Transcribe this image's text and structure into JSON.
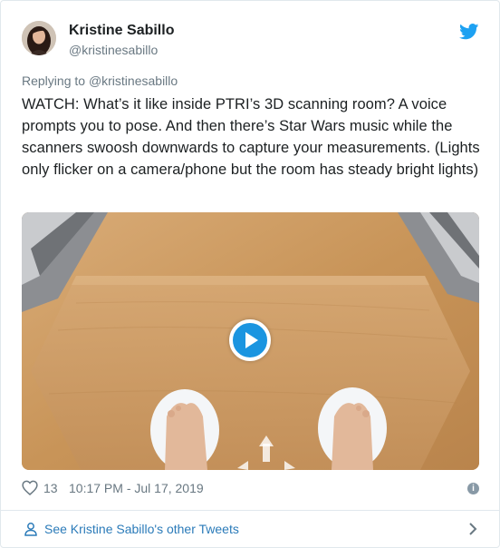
{
  "author": {
    "name": "Kristine Sabillo",
    "handle": "@kristinesabillo"
  },
  "reply": {
    "prefix": "Replying to",
    "handle": "@kristinesabillo"
  },
  "tweet": {
    "text": "WATCH: What’s it like inside PTRI’s 3D scanning room? A voice prompts you to pose. And then there’s Star Wars music while the scanners swoosh downwards to capture your measurements. (Lights only flicker on a camera/phone but the room has steady bright lights)"
  },
  "stats": {
    "likes": "13",
    "timestamp": "10:17 PM - Jul 17, 2019"
  },
  "footer": {
    "see_more": "See Kristine Sabillo's other Tweets"
  },
  "colors": {
    "link": "#2b7bb9",
    "twitter_blue": "#1da1f2",
    "play_blue": "#1b95e0",
    "muted": "#697882",
    "text": "#1c2022"
  },
  "icons": {
    "brand": "twitter-bird-icon",
    "like": "heart-icon",
    "info": "info-icon",
    "person": "person-icon",
    "chevron": "chevron-right-icon",
    "play": "play-icon"
  }
}
